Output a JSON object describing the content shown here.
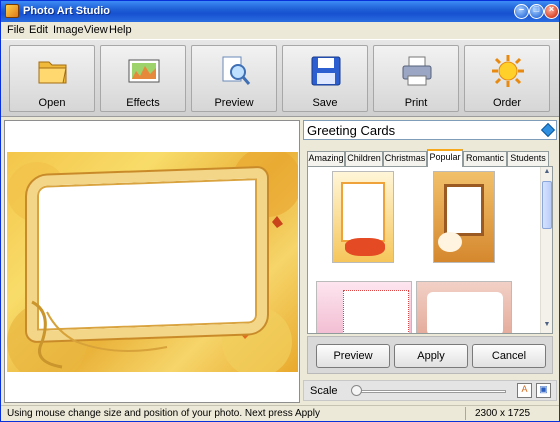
{
  "window": {
    "title": "Photo Art Studio"
  },
  "menu": [
    "File",
    "Edit",
    "Image",
    "View",
    "Help"
  ],
  "toolbar": [
    {
      "label": "Open",
      "icon": "folder-icon"
    },
    {
      "label": "Effects",
      "icon": "effects-icon"
    },
    {
      "label": "Preview",
      "icon": "preview-icon"
    },
    {
      "label": "Save",
      "icon": "floppy-icon"
    },
    {
      "label": "Print",
      "icon": "printer-icon"
    },
    {
      "label": "Order",
      "icon": "sun-icon"
    }
  ],
  "category": {
    "selected": "Greeting Cards"
  },
  "tabs": [
    "Amazing",
    "Children",
    "Christmas",
    "Popular",
    "Romantic",
    "Students"
  ],
  "active_tab": "Popular",
  "actions": {
    "preview": "Preview",
    "apply": "Apply",
    "cancel": "Cancel"
  },
  "scale": {
    "label": "Scale",
    "level": 0
  },
  "status": {
    "message": "Using mouse change size and position of your photo. Next press Apply",
    "dimensions": "2300 x 1725"
  },
  "colors": {
    "titlebar": "#1e5fd6",
    "accent_tab": "#f7a81b"
  }
}
